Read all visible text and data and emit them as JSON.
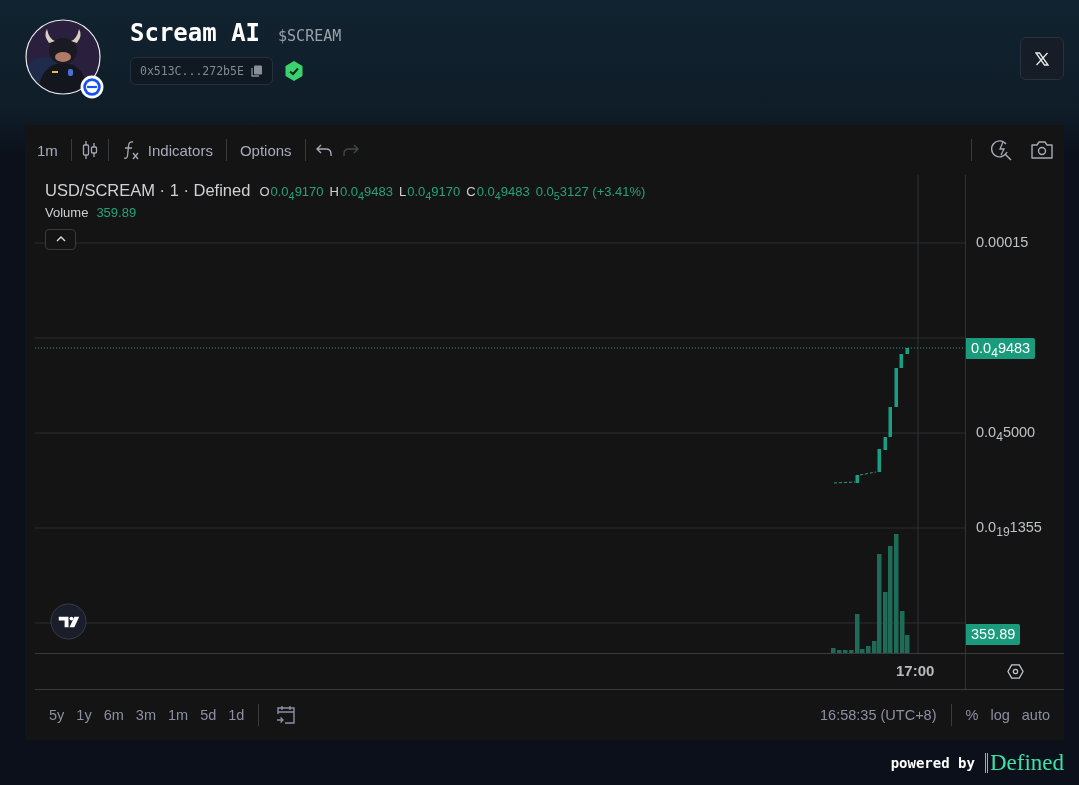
{
  "token": {
    "name": "Scream AI",
    "ticker": "$SCREAM",
    "address": "0x513C...272b5E",
    "verified": true
  },
  "toolbar": {
    "interval": "1m",
    "indicators": "Indicators",
    "options": "Options",
    "undo": {
      "disabled": false
    },
    "redo": {
      "disabled": true
    }
  },
  "legend": {
    "pair": "USD/SCREAM · 1 · Defined",
    "ohlc": [
      {
        "label": "O",
        "value": "0.0$_{4}$9170"
      },
      {
        "label": "H",
        "value": "0.0$_{4}$9483"
      },
      {
        "label": "L",
        "value": "0.0$_{4}$9170"
      },
      {
        "label": "C",
        "value": "0.0$_{4}$9483"
      }
    ],
    "change": "0.0$_{5}$3127 (+3.41%)",
    "volume_label": "Volume",
    "volume_value": "359.89"
  },
  "price_axis": {
    "ticks": [
      "0.00015",
      "0.0$_{4}$5000",
      "0.0$_{19}$1355"
    ],
    "price_tag": "0.0$_{4}$9483",
    "volume_tag": "359.89"
  },
  "time_axis": {
    "label": "17:00"
  },
  "ranges": [
    "5y",
    "1y",
    "6m",
    "3m",
    "1m",
    "5d",
    "1d"
  ],
  "status": {
    "time": "16:58:35 (UTC+8)",
    "scale_options": [
      "%",
      "log",
      "auto"
    ]
  },
  "footer": {
    "powered_by": "powered by",
    "brand": "Defined"
  }
}
